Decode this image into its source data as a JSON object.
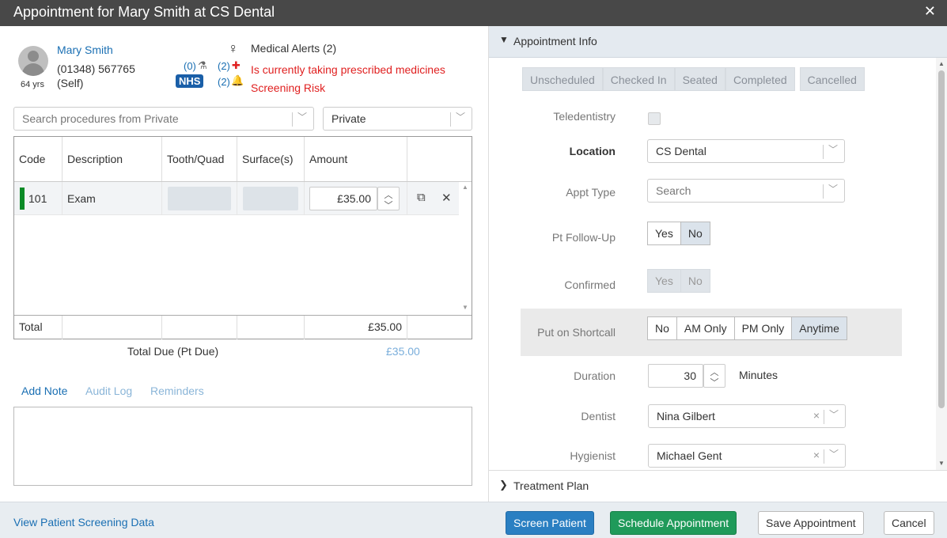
{
  "window": {
    "title": "Appointment for Mary Smith at CS Dental",
    "close_icon": "close-icon"
  },
  "patient": {
    "name": "Mary Smith",
    "phone": "(01348) 567765",
    "relation": "(Self)",
    "age": "64 yrs",
    "lab_count": "(0)",
    "med_count": "(2)",
    "alert_count": "(2)",
    "nhs_badge": "NHS"
  },
  "alerts": {
    "title": "Medical Alerts (2)",
    "items": [
      "Is currently taking prescribed medicines",
      "Screening Risk"
    ],
    "color": "#e02020"
  },
  "procedure_search": {
    "placeholder": "Search procedures from Private"
  },
  "fee_schedule": {
    "value": "Private"
  },
  "procedures": {
    "columns": [
      "Code",
      "Description",
      "Tooth/Quad",
      "Surface(s)",
      "Amount"
    ],
    "rows": [
      {
        "code": "101",
        "description": "Exam",
        "amount": "£35.00",
        "status_color": "#0a8a26"
      }
    ],
    "total_label": "Total",
    "total_amount": "£35.00"
  },
  "total_due": {
    "label": "Total Due (Pt Due)",
    "value": "£35.00"
  },
  "note_tabs": {
    "add_note": "Add Note",
    "audit_log": "Audit Log",
    "reminders": "Reminders"
  },
  "appointment_info": {
    "header": "Appointment Info",
    "status_buttons": [
      "Unscheduled",
      "Checked In",
      "Seated",
      "Completed",
      "Cancelled"
    ],
    "teledentistry_label": "Teledentistry",
    "location_label": "Location",
    "location_value": "CS Dental",
    "appt_type_label": "Appt Type",
    "appt_type_placeholder": "Search",
    "followup_label": "Pt Follow-Up",
    "followup_options": [
      "Yes",
      "No"
    ],
    "followup_selected": "No",
    "confirmed_label": "Confirmed",
    "confirmed_options": [
      "Yes",
      "No"
    ],
    "shortcall_label": "Put on Shortcall",
    "shortcall_options": [
      "No",
      "AM Only",
      "PM Only",
      "Anytime"
    ],
    "shortcall_selected": "Anytime",
    "duration_label": "Duration",
    "duration_value": "30",
    "duration_unit": "Minutes",
    "dentist_label": "Dentist",
    "dentist_value": "Nina Gilbert",
    "hygienist_label": "Hygienist",
    "hygienist_value": "Michael Gent"
  },
  "treatment_plan": {
    "header": "Treatment Plan"
  },
  "footer": {
    "screening_link": "View Patient Screening Data",
    "screen_patient": "Screen Patient",
    "schedule": "Schedule Appointment",
    "save": "Save Appointment",
    "cancel": "Cancel"
  },
  "colors": {
    "link": "#1a6fb3",
    "primary": "#2a7fc2",
    "success": "#1f9a5a",
    "titlebar": "#484848"
  }
}
